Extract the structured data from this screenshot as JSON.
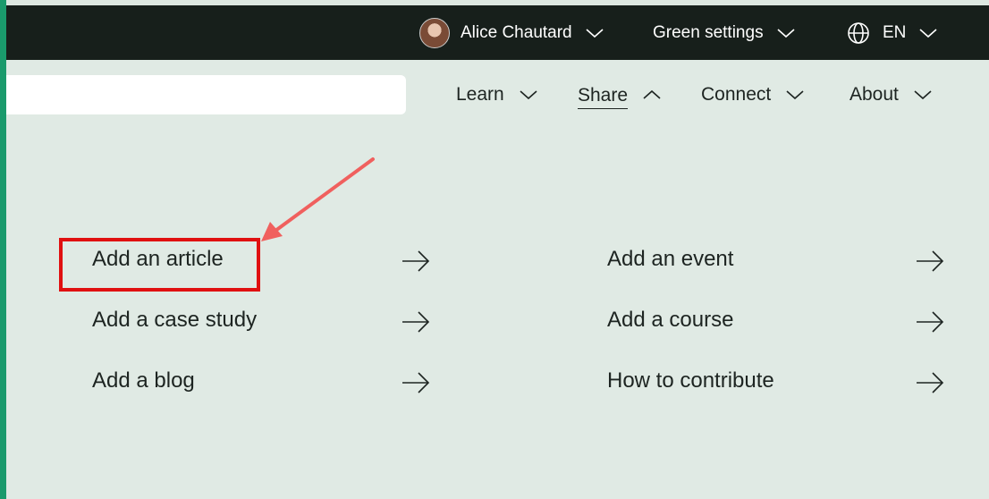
{
  "topbar": {
    "user_name": "Alice Chautard",
    "settings_label": "Green settings",
    "language": "EN"
  },
  "search": {
    "placeholder": ""
  },
  "nav": {
    "items": [
      {
        "label": "Learn",
        "state": "collapsed"
      },
      {
        "label": "Share",
        "state": "expanded"
      },
      {
        "label": "Connect",
        "state": "collapsed"
      },
      {
        "label": "About",
        "state": "collapsed"
      }
    ]
  },
  "share_menu": {
    "left": [
      "Add an article",
      "Add a case study",
      "Add a blog"
    ],
    "right": [
      "Add an event",
      "Add a course",
      "How to contribute"
    ]
  },
  "annotation": {
    "highlight_color": "#e01010",
    "arrow_color": "#f0605e"
  },
  "colors": {
    "accent": "#1a9a6c",
    "topbar_bg": "#171f1b",
    "page_bg": "#e0eae4"
  }
}
